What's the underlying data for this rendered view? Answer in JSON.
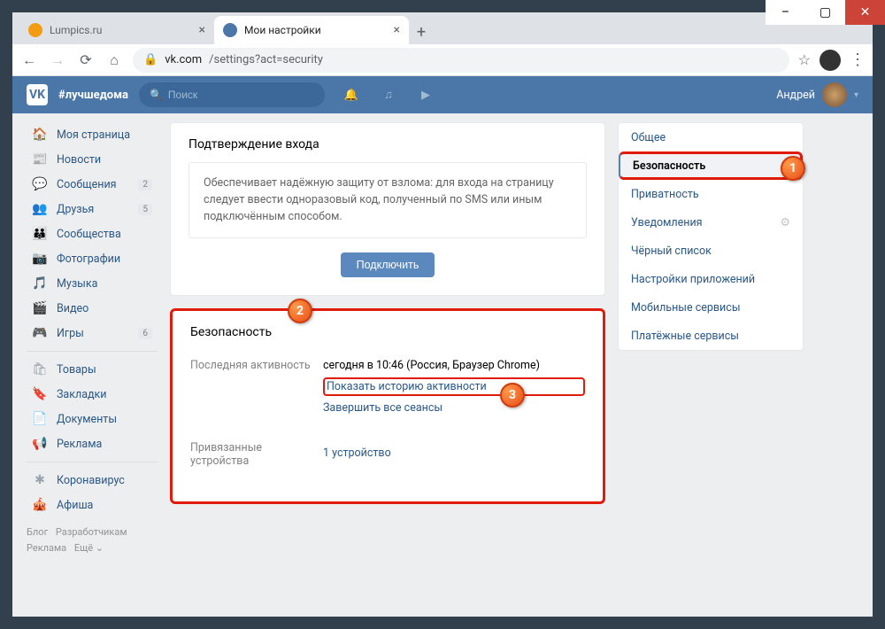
{
  "window": {
    "minimize": "–",
    "maximize": "▢",
    "close": "✕"
  },
  "tabs": [
    {
      "title": "Lumpics.ru",
      "favicon_color": "#f39c12",
      "active": false
    },
    {
      "title": "Мои настройки",
      "favicon_color": "#4a76a8",
      "active": true
    }
  ],
  "address": {
    "host": "vk.com",
    "path": "/settings?act=security"
  },
  "vk_header": {
    "slogan": "#лучшедома",
    "search_placeholder": "Поиск",
    "username": "Андрей"
  },
  "left_nav": {
    "group1": [
      {
        "icon": "🏠",
        "label": "Моя страница"
      },
      {
        "icon": "📰",
        "label": "Новости"
      },
      {
        "icon": "💬",
        "label": "Сообщения",
        "badge": "2"
      },
      {
        "icon": "👥",
        "label": "Друзья",
        "badge": "5"
      },
      {
        "icon": "👪",
        "label": "Сообщества"
      },
      {
        "icon": "📷",
        "label": "Фотографии"
      },
      {
        "icon": "🎵",
        "label": "Музыка"
      },
      {
        "icon": "🎬",
        "label": "Видео"
      },
      {
        "icon": "🎮",
        "label": "Игры",
        "badge": "6"
      }
    ],
    "group2": [
      {
        "icon": "🛍",
        "label": "Товары"
      },
      {
        "icon": "🔖",
        "label": "Закладки"
      },
      {
        "icon": "📄",
        "label": "Документы"
      },
      {
        "icon": "📢",
        "label": "Реклама"
      }
    ],
    "group3": [
      {
        "icon": "✱",
        "label": "Коронавирус"
      },
      {
        "icon": "🎪",
        "label": "Афиша"
      }
    ]
  },
  "footer": {
    "blog": "Блог",
    "devs": "Разработчикам",
    "ads": "Реклама",
    "more": "Ещё ⌄"
  },
  "login_confirm": {
    "title": "Подтверждение входа",
    "text": "Обеспечивает надёжную защиту от взлома: для входа на страницу следует ввести одноразовый код, полученный по SMS или иным подключённым способом.",
    "button": "Подключить"
  },
  "security": {
    "title": "Безопасность",
    "last_activity_label": "Последняя активность",
    "last_activity_value": "сегодня в 10:46 (Россия, Браузер Chrome)",
    "show_history": "Показать историю активности",
    "end_sessions": "Завершить все сеансы",
    "devices_label": "Привязанные устройства",
    "devices_value": "1 устройство"
  },
  "settings_menu": [
    {
      "label": "Общее"
    },
    {
      "label": "Безопасность",
      "active": true
    },
    {
      "label": "Приватность"
    },
    {
      "label": "Уведомления",
      "gear": true
    },
    {
      "label": "Чёрный список"
    },
    {
      "label": "Настройки приложений"
    },
    {
      "label": "Мобильные сервисы"
    },
    {
      "label": "Платёжные сервисы"
    }
  ],
  "markers": {
    "m1": "1",
    "m2": "2",
    "m3": "3"
  }
}
